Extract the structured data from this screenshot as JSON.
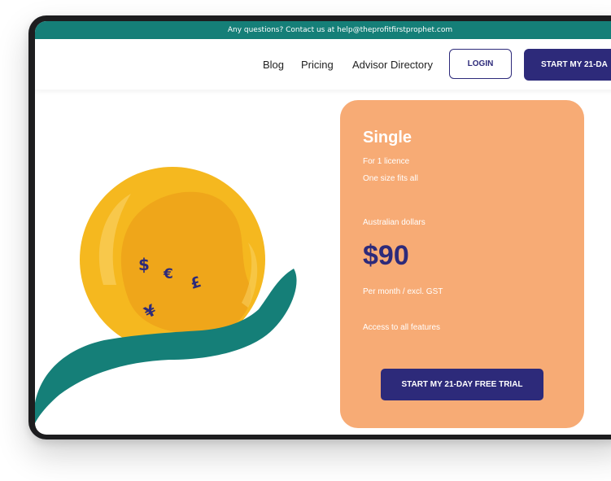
{
  "topbar": {
    "text": "Any questions? Contact us at help@theprofitfirstprophet.com"
  },
  "nav": {
    "links": [
      "Blog",
      "Pricing",
      "Advisor Directory"
    ],
    "login_label": "LOGIN",
    "trial_label": "START MY 21-DA"
  },
  "illustration": {
    "symbols": [
      "$",
      "€",
      "£",
      "¥"
    ]
  },
  "plan": {
    "name": "Single",
    "licences": "For 1 licence",
    "fit": "One size fits all",
    "currency": "Australian dollars",
    "price": "$90",
    "period": "Per month / excl. GST",
    "features": "Access to all features",
    "cta_label": "START MY 21-DAY FREE TRIAL"
  },
  "colors": {
    "teal": "#157f78",
    "navy": "#2d2a7a",
    "card": "#f7ab75",
    "coin": "#f5b81f"
  }
}
